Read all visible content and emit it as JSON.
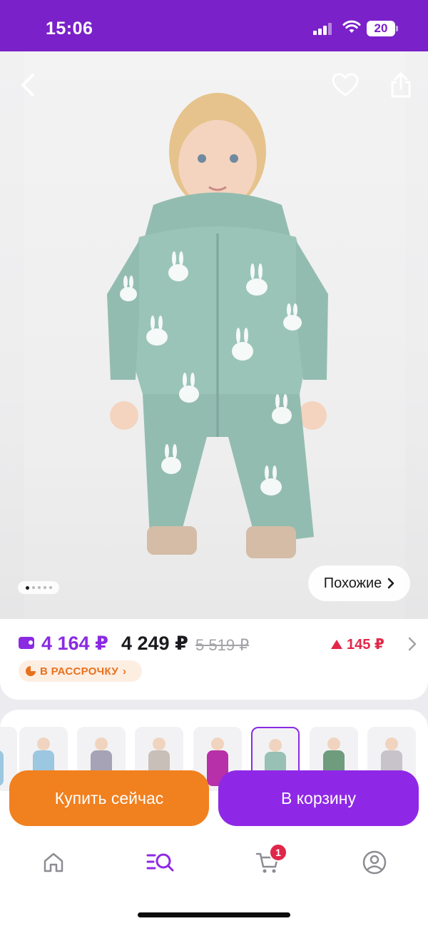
{
  "status_bar": {
    "time": "15:06",
    "battery": "20",
    "color": "#7a21c9"
  },
  "product": {
    "price_wallet": "4 164 ₽",
    "price_current": "4 249 ₽",
    "price_old": "5 519 ₽",
    "price_delta": "145 ₽",
    "installment_label": "В РАССРОЧКУ",
    "similar_label": "Похожие",
    "photo_index": 1,
    "photo_count": 5
  },
  "variants": [
    {
      "color": "#9cc7e0",
      "selected": false
    },
    {
      "color": "#a6a3b6",
      "selected": false
    },
    {
      "color": "#c7bfb8",
      "selected": false
    },
    {
      "color": "#b72fa9",
      "selected": false
    },
    {
      "color": "#98c0b5",
      "selected": true
    },
    {
      "color": "#6e9c7d",
      "selected": false
    },
    {
      "color": "#c8c3cb",
      "selected": false
    }
  ],
  "actions": {
    "buy_now": "Купить сейчас",
    "add_to_cart": "В корзину"
  },
  "tabbar": {
    "items": [
      {
        "name": "home",
        "icon": "home-icon"
      },
      {
        "name": "catalog",
        "icon": "catalog-search-icon"
      },
      {
        "name": "cart",
        "icon": "cart-icon"
      },
      {
        "name": "profile",
        "icon": "profile-icon"
      }
    ],
    "cart_badge": "1"
  },
  "colors": {
    "accent": "#8f28e6",
    "buy": "#f1801f",
    "delta": "#e2284a",
    "installment": "#e8711e"
  }
}
